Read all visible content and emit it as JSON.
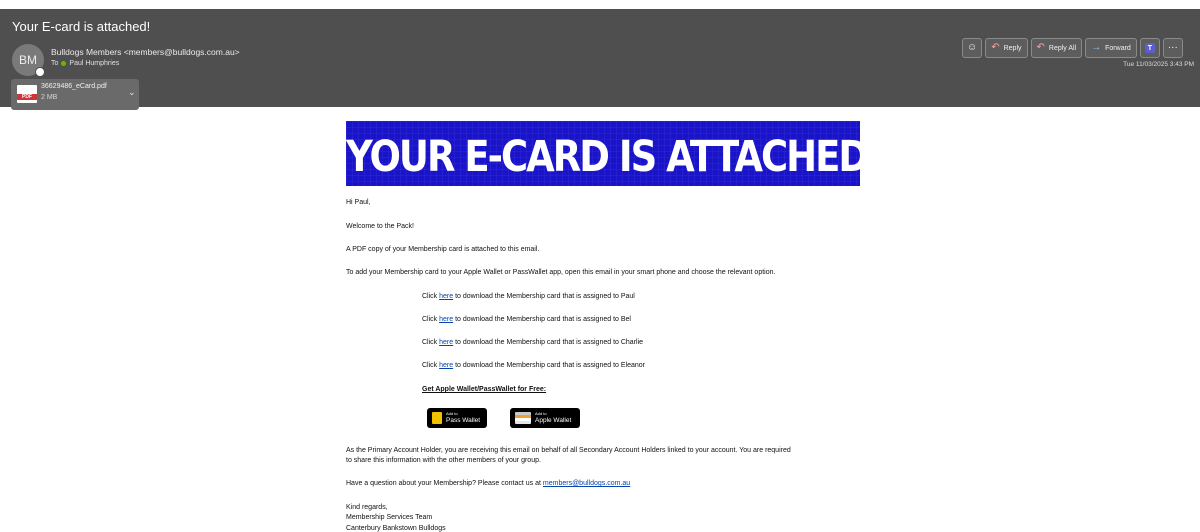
{
  "header": {
    "subject": "Your E-card is attached!",
    "avatar_initials": "BM",
    "from": "Bulldogs Members <members@bulldogs.com.au>",
    "to_label": "To",
    "to_name": "Paul Humphries",
    "date": "Tue 11/03/2025 3:43 PM"
  },
  "attachment": {
    "badge": "PDF",
    "name": "36629486_eCard.pdf",
    "size": "2 MB",
    "chevron": "⌄"
  },
  "actions": {
    "emoji_icon": "☺",
    "reply": "Reply",
    "reply_icon": "↶",
    "reply_all": "Reply All",
    "reply_all_icon": "↶",
    "forward": "Forward",
    "forward_icon": "→",
    "teams_icon": "T",
    "more": "···"
  },
  "email": {
    "banner": "YOUR E-CARD IS ATTACHED",
    "greeting": "Hi Paul,",
    "welcome": "Welcome to the Pack!",
    "pdf_line": "A PDF copy of your Membership card is attached to this email.",
    "wallet_line": "To add your Membership card to your Apple Wallet or PassWallet app, open this email in your smart phone and choose the relevant option.",
    "links": [
      {
        "pre": "Click ",
        "link": "here",
        "post": " to download the Membership card that is assigned to Paul"
      },
      {
        "pre": "Click ",
        "link": "here",
        "post": " to download the Membership card that is assigned to Bel"
      },
      {
        "pre": "Click ",
        "link": "here",
        "post": " to download the Membership card that is assigned to Charlie"
      },
      {
        "pre": "Click ",
        "link": "here",
        "post": " to download the Membership card that is assigned to Eleanor"
      }
    ],
    "get_wallet": "Get Apple Wallet/PassWallet for Free:",
    "pass_wallet": {
      "small": "Add to",
      "big": "Pass Wallet"
    },
    "apple_wallet": {
      "small": "Add to",
      "big": "Apple Wallet"
    },
    "primary_1": "As the Primary Account Holder, you are receiving this email on behalf of all Secondary Account Holders linked to your account. You are required",
    "primary_2": "to share this information with the other members of your group.",
    "question": "Have a question about your Membership? Please contact us at ",
    "contact_email": "members@bulldogs.com.au",
    "regards": "Kind regards,",
    "team": "Membership Services Team",
    "club": "Canterbury Bankstown Bulldogs"
  },
  "colors": {
    "banner_blue": "#1a14c8",
    "link": "#0645ad",
    "header_bg": "#4f4f4f"
  }
}
